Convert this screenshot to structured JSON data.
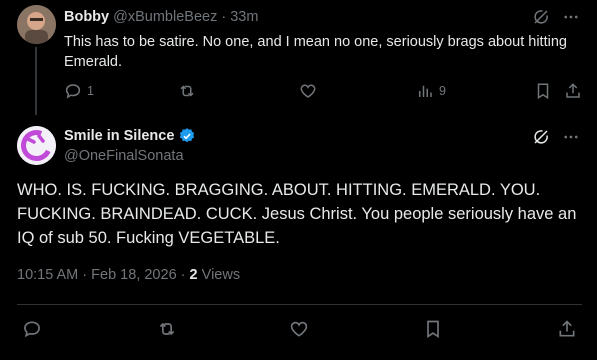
{
  "reply_tweet": {
    "display_name": "Bobby",
    "handle": "@xBumbleBeez",
    "separator": "·",
    "time_ago": "33m",
    "text": "This has to be satire. No one, and I mean no one, seriously brags about hitting Emerald.",
    "reply_count": "1",
    "view_count": "9"
  },
  "main_tweet": {
    "display_name": "Smile in Silence",
    "handle": "@OneFinalSonata",
    "verified": true,
    "text": "WHO. IS. FUCKING. BRAGGING. ABOUT. HITTING. EMERALD. YOU. FUCKING. BRAINDEAD. CUCK. Jesus Christ. You people seriously have an IQ of sub 50. Fucking VEGETABLE.",
    "time": "10:15 AM",
    "date": "Feb 18, 2026",
    "separator": "·",
    "view_count": "2",
    "views_label": "Views"
  },
  "colors": {
    "background": "#000000",
    "text_primary": "#e7e9ea",
    "text_secondary": "#71767b",
    "verified_badge": "#1d9bf0",
    "divider": "#2f3336"
  },
  "icons": [
    "grok-icon",
    "more-icon",
    "reply-icon",
    "retweet-icon",
    "like-icon",
    "views-icon",
    "bookmark-icon",
    "share-icon",
    "verified-badge-icon"
  ]
}
